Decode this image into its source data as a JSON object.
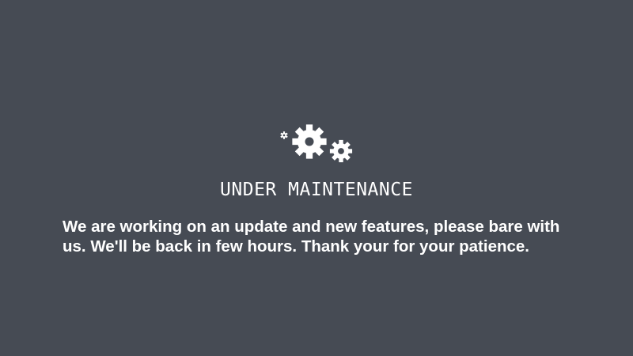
{
  "page": {
    "background_color": "#464b54",
    "text_color": "#ffffff"
  },
  "icons": [
    "gear-icon",
    "gear-icon",
    "gear-icon"
  ],
  "maintenance": {
    "title": "UNDER MAINTENANCE",
    "message": "We are working on an update and new features, please bare with us. We'll be back in few hours. Thank your for your patience."
  }
}
